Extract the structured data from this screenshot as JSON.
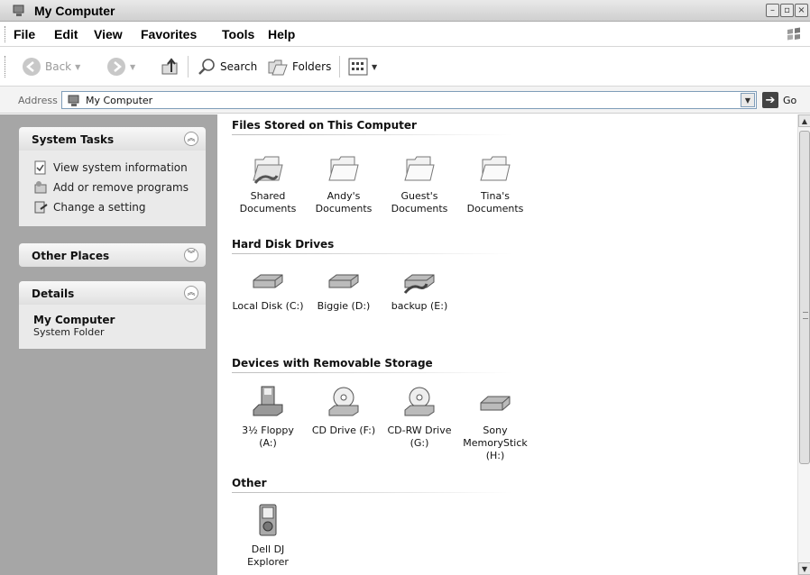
{
  "window": {
    "title": "My Computer",
    "icon": "my-computer-icon"
  },
  "menu": [
    "File",
    "Edit",
    "View",
    "Favorites",
    "Tools",
    "Help"
  ],
  "toolbar": {
    "back_label": "Back",
    "search_label": "Search",
    "folders_label": "Folders"
  },
  "address": {
    "label": "Address",
    "value": "My Computer",
    "go_label": "Go"
  },
  "task_pane": {
    "system_tasks": {
      "title": "System Tasks",
      "items": [
        "View system information",
        "Add or remove programs",
        "Change a setting"
      ]
    },
    "other_places": {
      "title": "Other Places"
    },
    "details": {
      "title": "Details",
      "name": "My Computer",
      "type": "System Folder"
    }
  },
  "groups": {
    "files": {
      "title": "Files Stored on This Computer",
      "items": [
        [
          "Shared",
          "Documents"
        ],
        [
          "Andy's",
          "Documents"
        ],
        [
          "Guest's",
          "Documents"
        ],
        [
          "Tina's",
          "Documents"
        ]
      ]
    },
    "hdd": {
      "title": "Hard Disk Drives",
      "items": [
        "Local Disk (C:)",
        "Biggie (D:)",
        "backup (E:)"
      ]
    },
    "removable": {
      "title": "Devices with Removable Storage",
      "items": [
        [
          "3½ Floppy",
          "(A:)"
        ],
        [
          "CD Drive (F:)"
        ],
        [
          "CD-RW Drive",
          "(G:)"
        ],
        [
          "Sony",
          "MemoryStick",
          "(H:)"
        ]
      ]
    },
    "other": {
      "title": "Other",
      "items": [
        [
          "Dell DJ",
          "Explorer"
        ]
      ]
    }
  }
}
